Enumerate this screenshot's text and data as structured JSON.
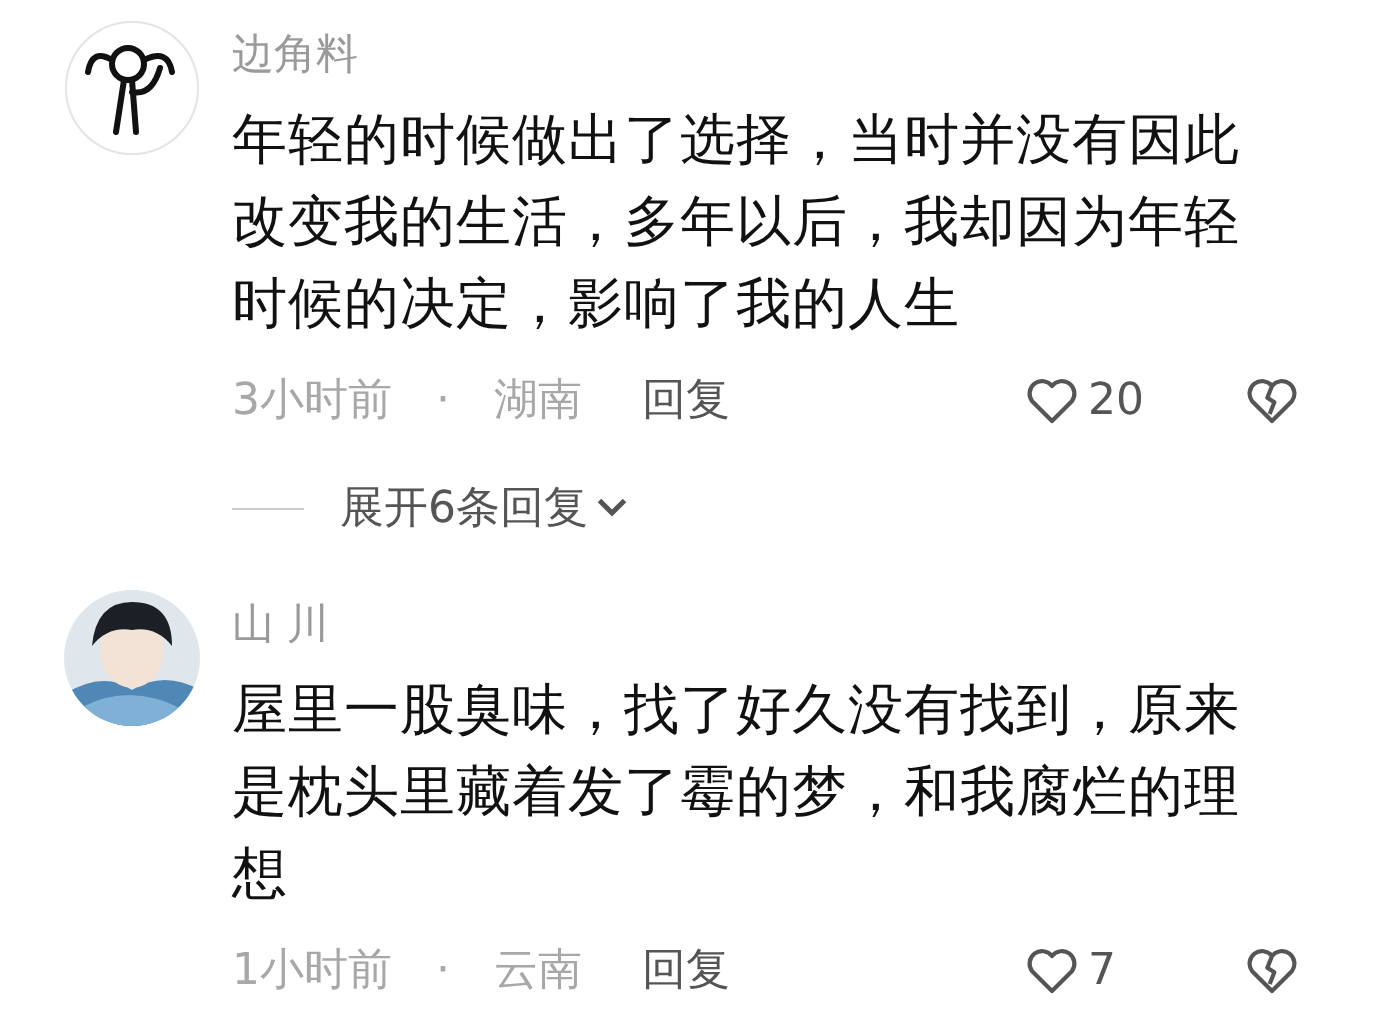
{
  "comments": [
    {
      "author": "边角料",
      "avatar": {
        "kind": "drawing"
      },
      "text": "年轻的时候做出了选择，当时并没有因此改变我的生活，多年以后，我却因为年轻时候的决定，影响了我的人生",
      "time": "3小时前",
      "separator": "·",
      "location": "湖南",
      "reply": "回复",
      "likes": "20",
      "liked": false,
      "expand": "展开6条回复"
    },
    {
      "author": "山 川",
      "text": "屋里一股臭味，找了好久没有找到，原来是枕头里藏着发了霉的梦，和我腐烂的理想",
      "time": "1小时前",
      "separator": "·",
      "location": "云南",
      "reply": "回复",
      "likes": "7",
      "liked": false
    }
  ]
}
